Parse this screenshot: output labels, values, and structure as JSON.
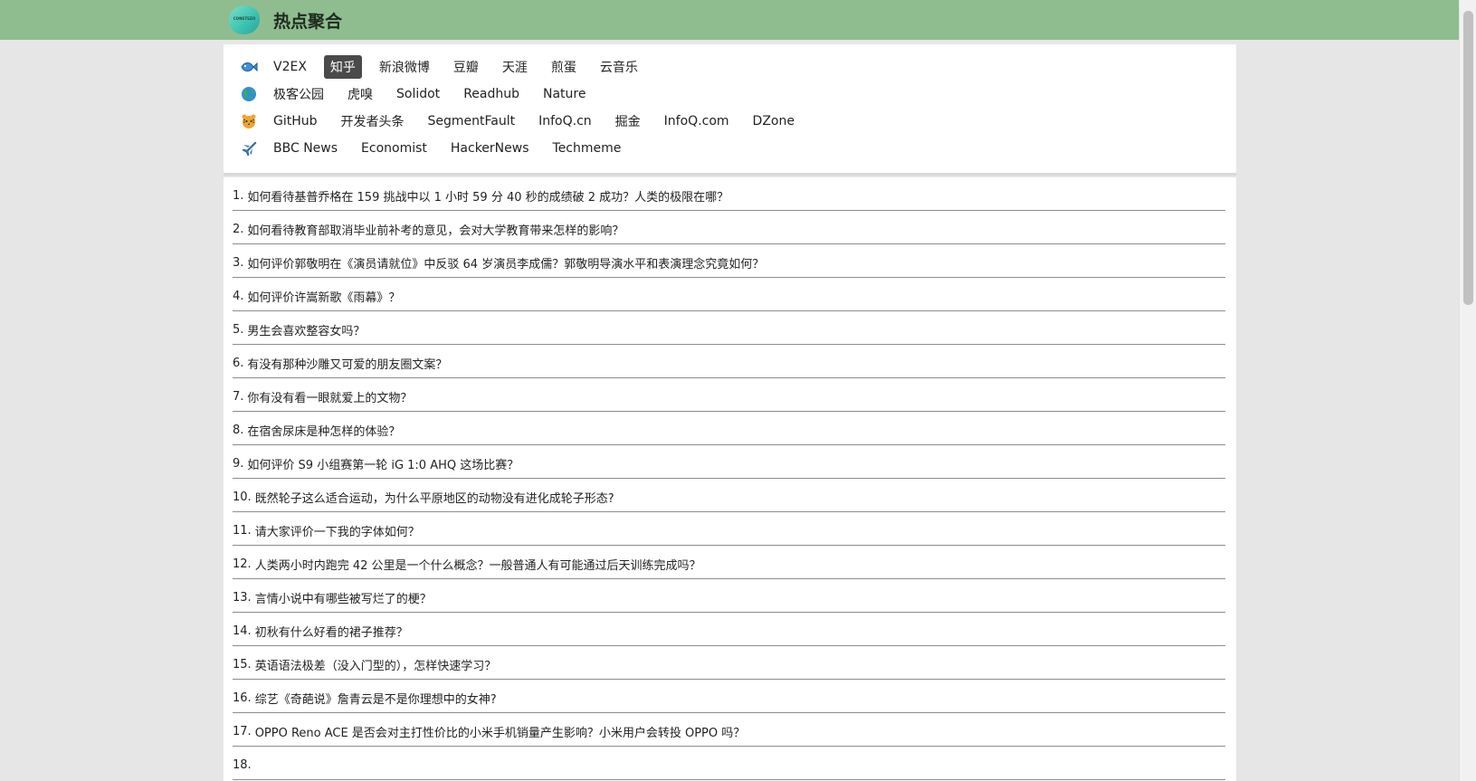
{
  "header": {
    "logo_text": "CONSTSZO",
    "title": "热点聚合"
  },
  "nav": {
    "rows": [
      {
        "icon": "fish-icon",
        "items": [
          "V2EX",
          "知乎",
          "新浪微博",
          "豆瓣",
          "天涯",
          "煎蛋",
          "云音乐"
        ],
        "active_index": 1
      },
      {
        "icon": "globe-icon",
        "items": [
          "极客公园",
          "虎嗅",
          "Solidot",
          "Readhub",
          "Nature"
        ],
        "active_index": -1
      },
      {
        "icon": "tiger-icon",
        "items": [
          "GitHub",
          "开发者头条",
          "SegmentFault",
          "InfoQ.cn",
          "掘金",
          "InfoQ.com",
          "DZone"
        ],
        "active_index": -1
      },
      {
        "icon": "plane-icon",
        "items": [
          "BBC News",
          "Economist",
          "HackerNews",
          "Techmeme"
        ],
        "active_index": -1
      }
    ]
  },
  "list": {
    "items": [
      {
        "num": "1.",
        "text": "如何看待基普乔格在 159 挑战中以 1 小时 59 分 40 秒的成绩破 2 成功？人类的极限在哪？"
      },
      {
        "num": "2.",
        "text": "如何看待教育部取消毕业前补考的意见，会对大学教育带来怎样的影响？"
      },
      {
        "num": "3.",
        "text": "如何评价郭敬明在《演员请就位》中反驳 64 岁演员李成儒？郭敬明导演水平和表演理念究竟如何？"
      },
      {
        "num": "4.",
        "text": "如何评价许嵩新歌《雨幕》？"
      },
      {
        "num": "5.",
        "text": "男生会喜欢整容女吗？"
      },
      {
        "num": "6.",
        "text": "有没有那种沙雕又可爱的朋友圈文案？"
      },
      {
        "num": "7.",
        "text": "你有没有看一眼就爱上的文物？"
      },
      {
        "num": "8.",
        "text": "在宿舍尿床是种怎样的体验？"
      },
      {
        "num": "9.",
        "text": "如何评价 S9 小组赛第一轮 iG 1:0 AHQ 这场比赛？"
      },
      {
        "num": "10.",
        "text": "既然轮子这么适合运动，为什么平原地区的动物没有进化成轮子形态?"
      },
      {
        "num": "11.",
        "text": "请大家评价一下我的字体如何？"
      },
      {
        "num": "12.",
        "text": "人类两小时内跑完 42 公里是一个什么概念？一般普通人有可能通过后天训练完成吗？"
      },
      {
        "num": "13.",
        "text": "言情小说中有哪些被写烂了的梗？"
      },
      {
        "num": "14.",
        "text": "初秋有什么好看的裙子推荐？"
      },
      {
        "num": "15.",
        "text": "英语语法极差（没入门型的），怎样快速学习？"
      },
      {
        "num": "16.",
        "text": "综艺《奇葩说》詹青云是不是你理想中的女神?"
      },
      {
        "num": "17.",
        "text": "OPPO Reno ACE 是否会对主打性价比的小米手机销量产生影响？小米用户会转投 OPPO 吗？"
      },
      {
        "num": "18.",
        "text": ""
      }
    ]
  },
  "colors": {
    "header_bg": "#8fbd8f",
    "active_tab_bg": "#4a4a4a",
    "page_bg": "#e6e6e6"
  }
}
